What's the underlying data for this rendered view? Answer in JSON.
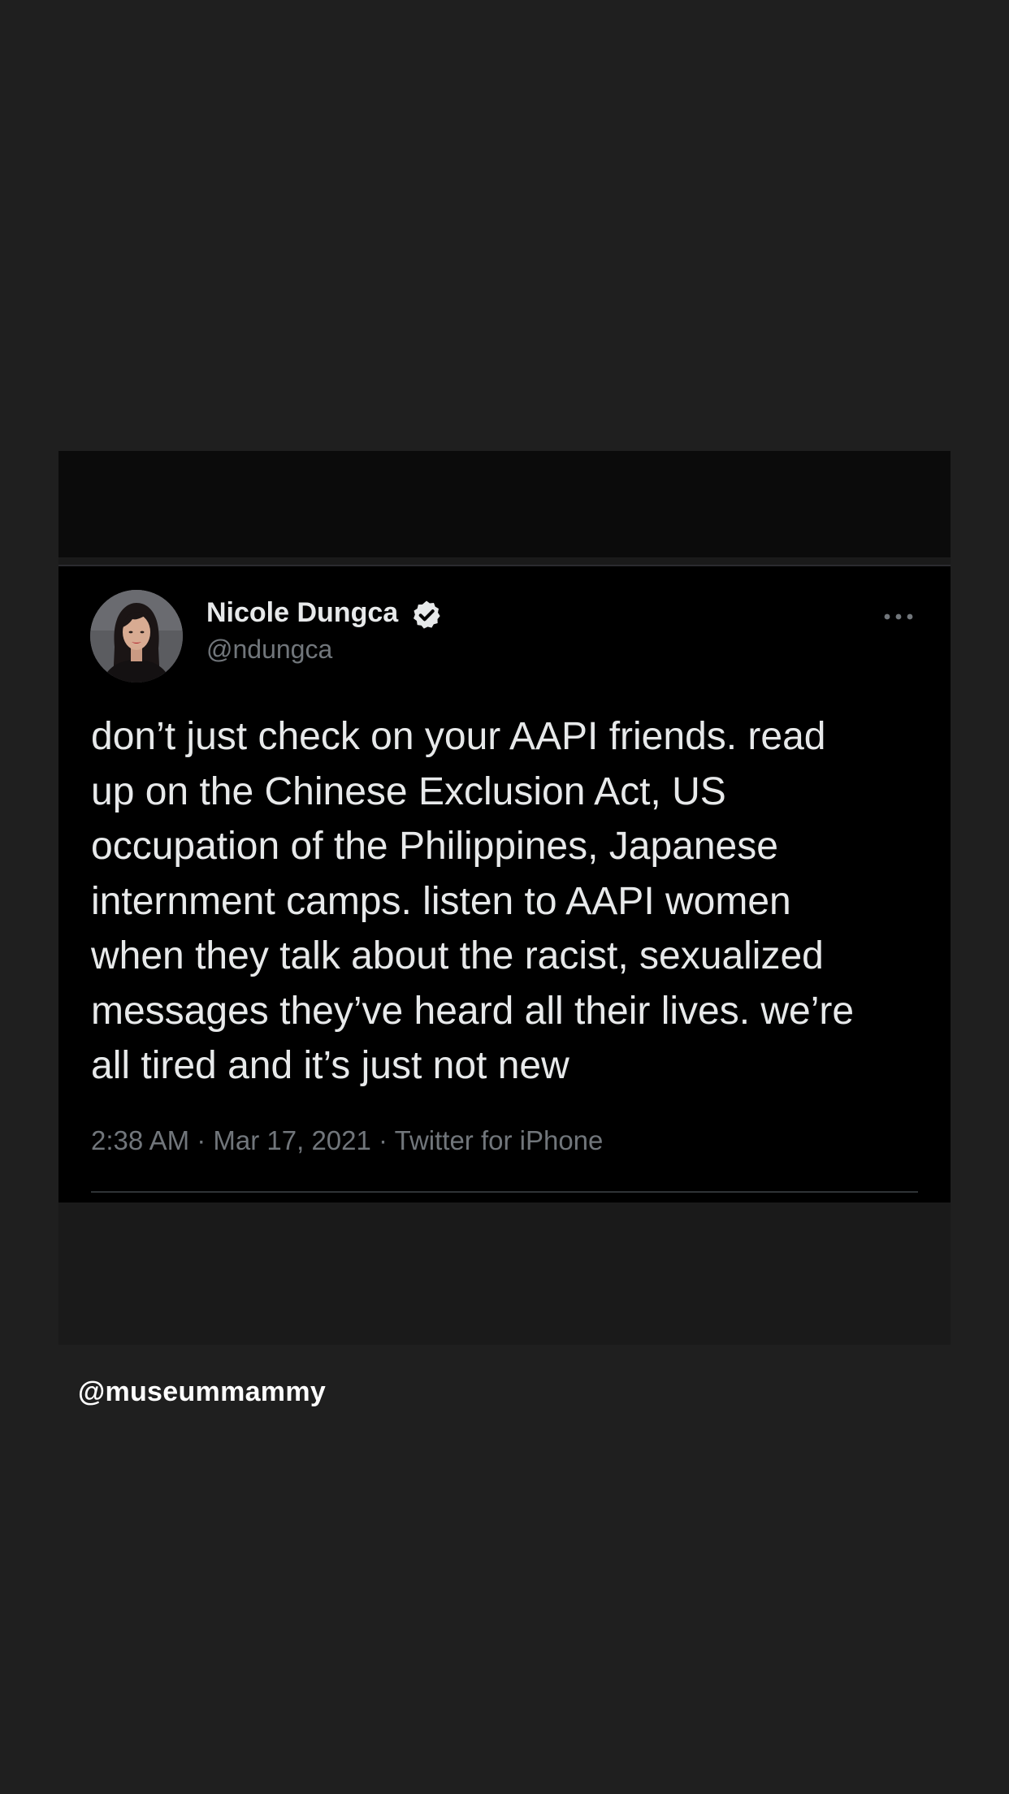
{
  "tweet": {
    "display_name": "Nicole Dungca",
    "handle": "@ndungca",
    "verified": true,
    "text": "don’t just check on your AAPI friends. read\nup on the Chinese Exclusion Act, US\noccupation of the Philippines, Japanese\ninternment camps. listen to AAPI women\nwhen they talk about the racist, sexualized\nmessages they’ve heard all their lives. we’re\nall tired and it’s just not new",
    "time": "2:38 AM",
    "date": "Mar 17, 2021",
    "source": "Twitter for iPhone"
  },
  "credit": "@museummammy",
  "colors": {
    "background": "#1f1f1f",
    "tweet_background": "#000000",
    "primary_text": "#e7e9ea",
    "secondary_text": "#71767b",
    "divider": "#2f3336"
  },
  "icons": {
    "verified": "verified-badge-icon",
    "more": "more-options-icon"
  }
}
